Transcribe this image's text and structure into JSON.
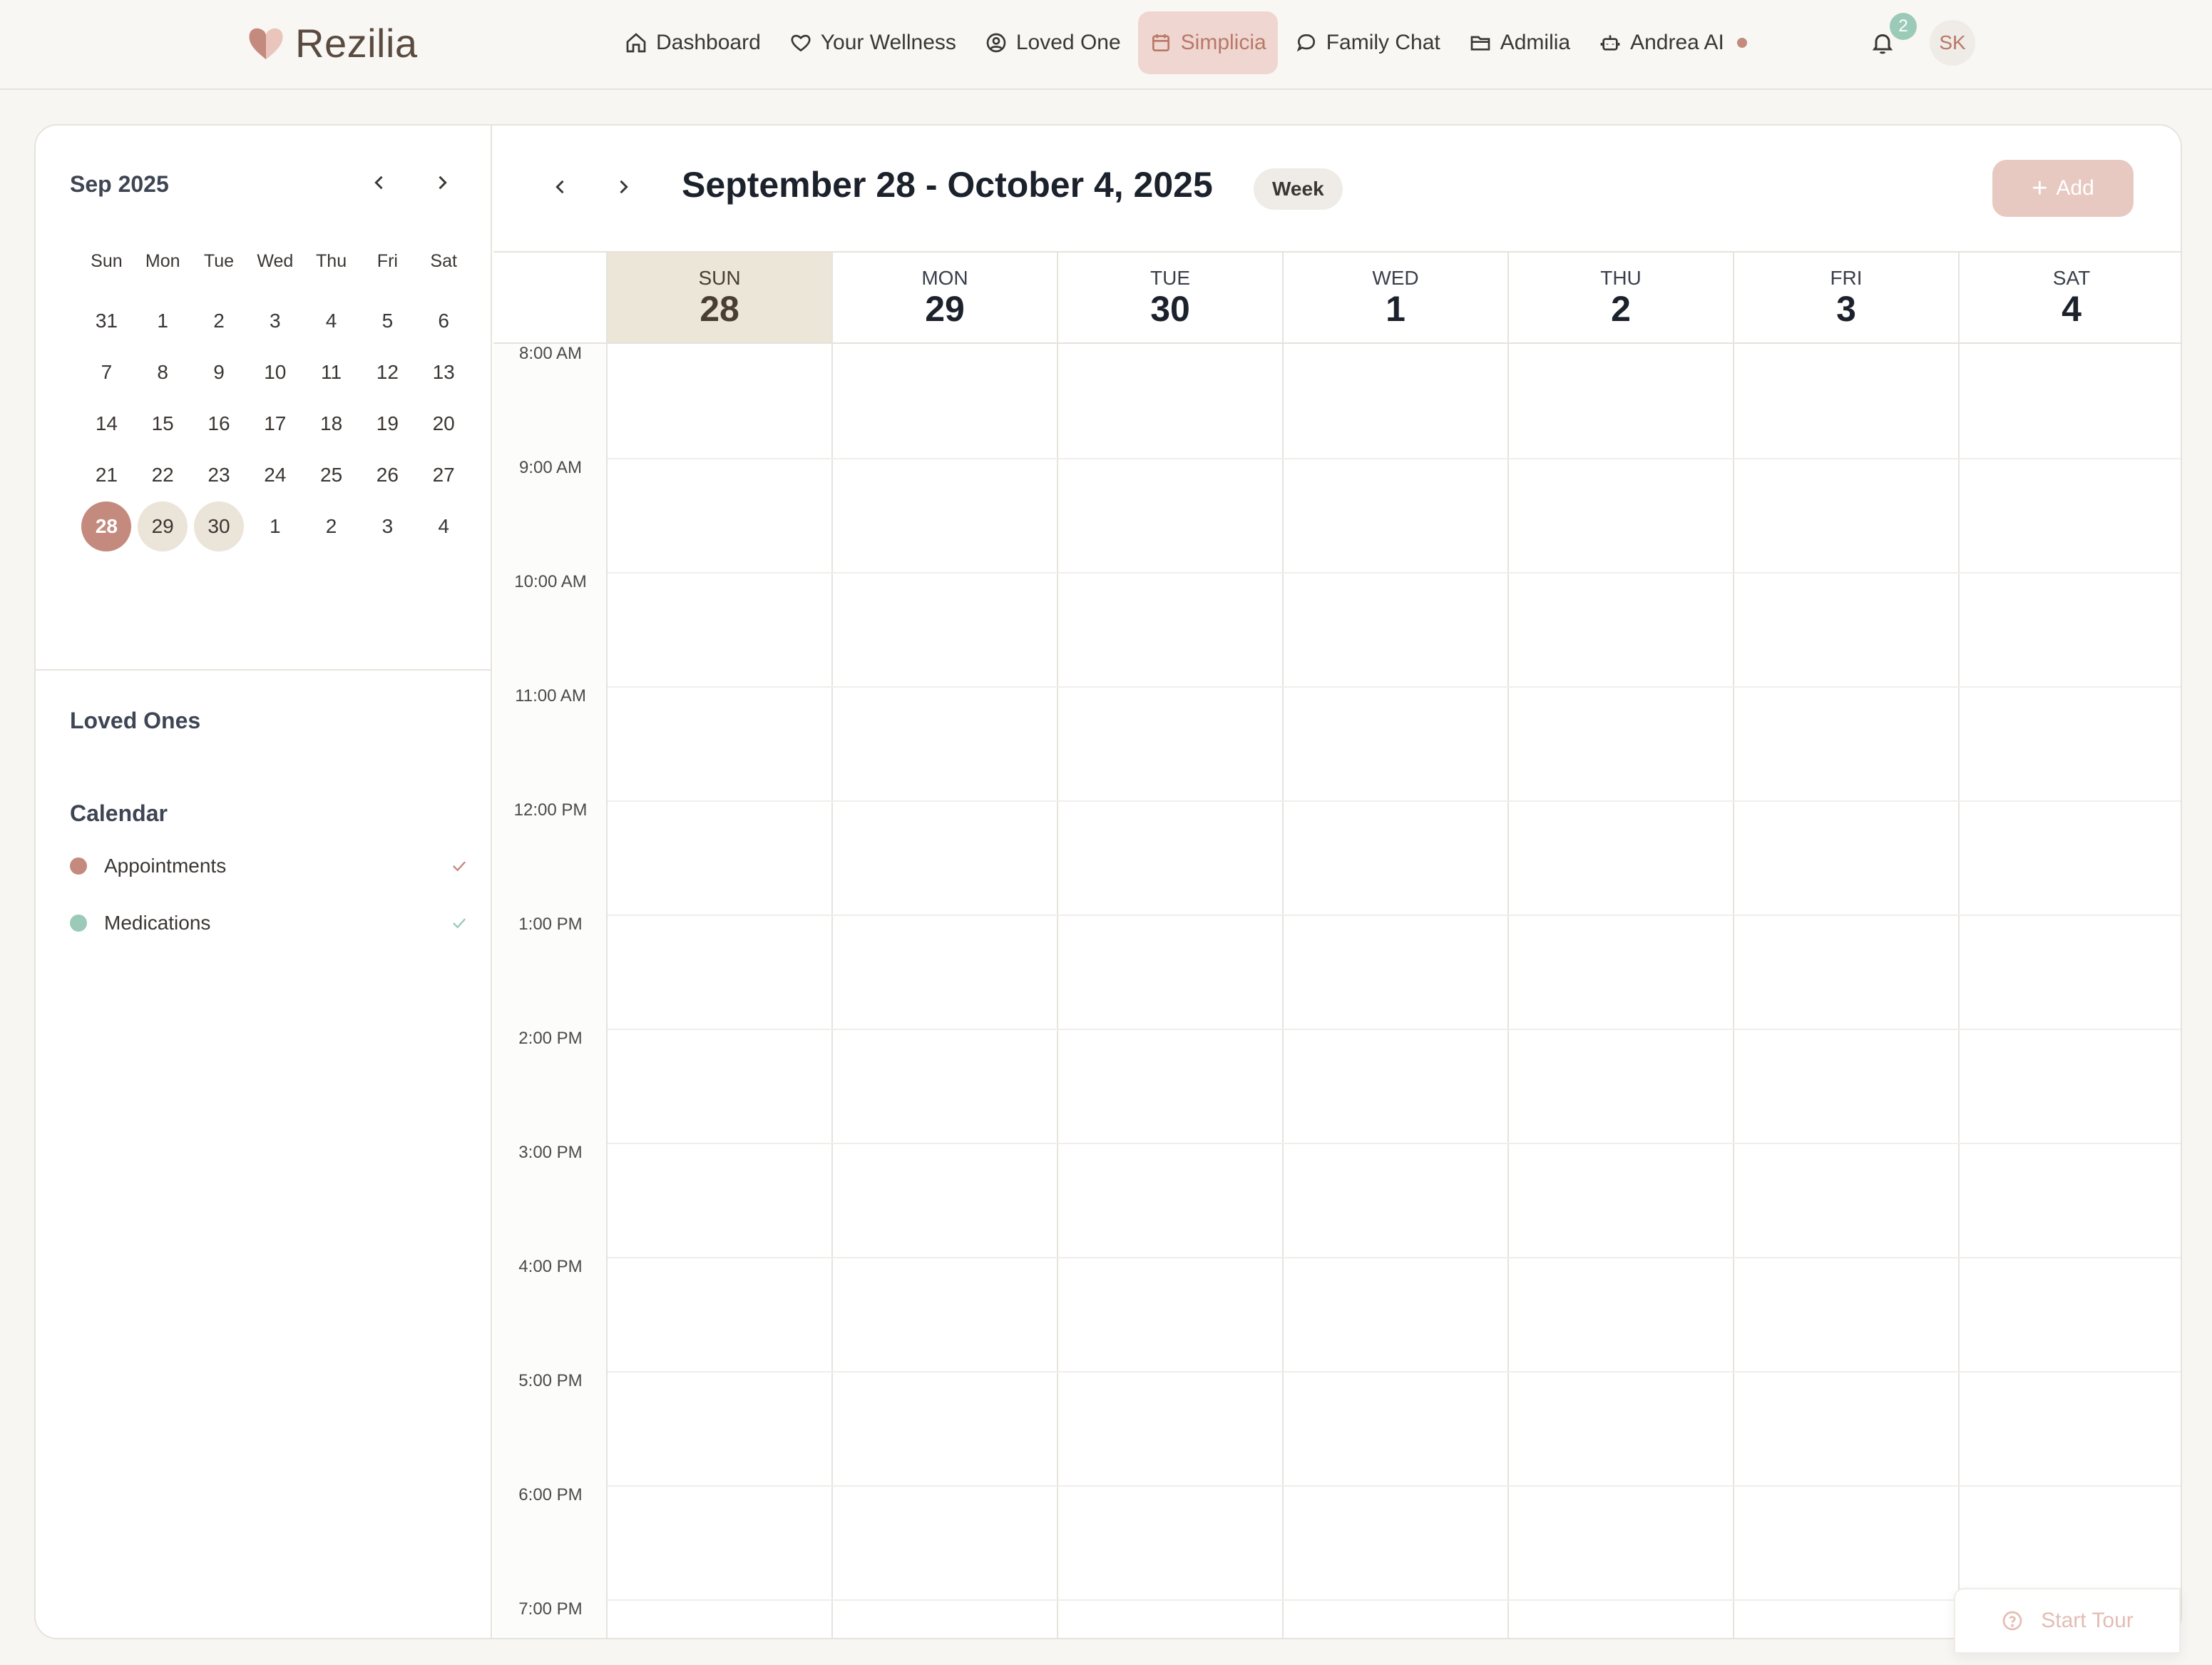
{
  "brand": {
    "name": "Rezilia"
  },
  "nav": {
    "items": [
      {
        "label": "Dashboard",
        "icon": "home-icon"
      },
      {
        "label": "Your Wellness",
        "icon": "heart-icon"
      },
      {
        "label": "Loved One",
        "icon": "user-circle-icon"
      },
      {
        "label": "Simplicia",
        "icon": "calendar-icon",
        "active": true
      },
      {
        "label": "Family Chat",
        "icon": "chat-bubble-icon"
      },
      {
        "label": "Admilia",
        "icon": "folder-icon"
      },
      {
        "label": "Andrea AI",
        "icon": "robot-icon"
      }
    ],
    "notifications_count": "2",
    "avatar_initials": "SK"
  },
  "mini_calendar": {
    "title": "Sep 2025",
    "weekdays": [
      "Sun",
      "Mon",
      "Tue",
      "Wed",
      "Thu",
      "Fri",
      "Sat"
    ],
    "weeks": [
      [
        "31",
        "1",
        "2",
        "3",
        "4",
        "5",
        "6"
      ],
      [
        "7",
        "8",
        "9",
        "10",
        "11",
        "12",
        "13"
      ],
      [
        "14",
        "15",
        "16",
        "17",
        "18",
        "19",
        "20"
      ],
      [
        "21",
        "22",
        "23",
        "24",
        "25",
        "26",
        "27"
      ],
      [
        "28",
        "29",
        "30",
        "1",
        "2",
        "3",
        "4"
      ]
    ]
  },
  "sidebar": {
    "loved_ones_title": "Loved Ones",
    "calendar_title": "Calendar",
    "calendars": [
      {
        "label": "Appointments",
        "color": "#c48a7d",
        "checked": true
      },
      {
        "label": "Medications",
        "color": "#9ccab8",
        "checked": true
      }
    ]
  },
  "week_view": {
    "title": "September 28 - October 4, 2025",
    "view_mode": "Week",
    "add_label": "Add",
    "days": [
      {
        "name": "SUN",
        "num": "28",
        "today": true
      },
      {
        "name": "MON",
        "num": "29"
      },
      {
        "name": "TUE",
        "num": "30"
      },
      {
        "name": "WED",
        "num": "1"
      },
      {
        "name": "THU",
        "num": "2"
      },
      {
        "name": "FRI",
        "num": "3"
      },
      {
        "name": "SAT",
        "num": "4"
      }
    ],
    "time_slots": [
      "8:00 AM",
      "9:00 AM",
      "10:00 AM",
      "11:00 AM",
      "12:00 PM",
      "1:00 PM",
      "2:00 PM",
      "3:00 PM",
      "4:00 PM",
      "5:00 PM",
      "6:00 PM",
      "7:00 PM"
    ]
  },
  "tour": {
    "label": "Start Tour"
  },
  "colors": {
    "accent": "#c48a7d",
    "medication": "#9ccab8",
    "today_bg": "#ebe6d8",
    "active_nav_bg": "#efd6d0"
  }
}
